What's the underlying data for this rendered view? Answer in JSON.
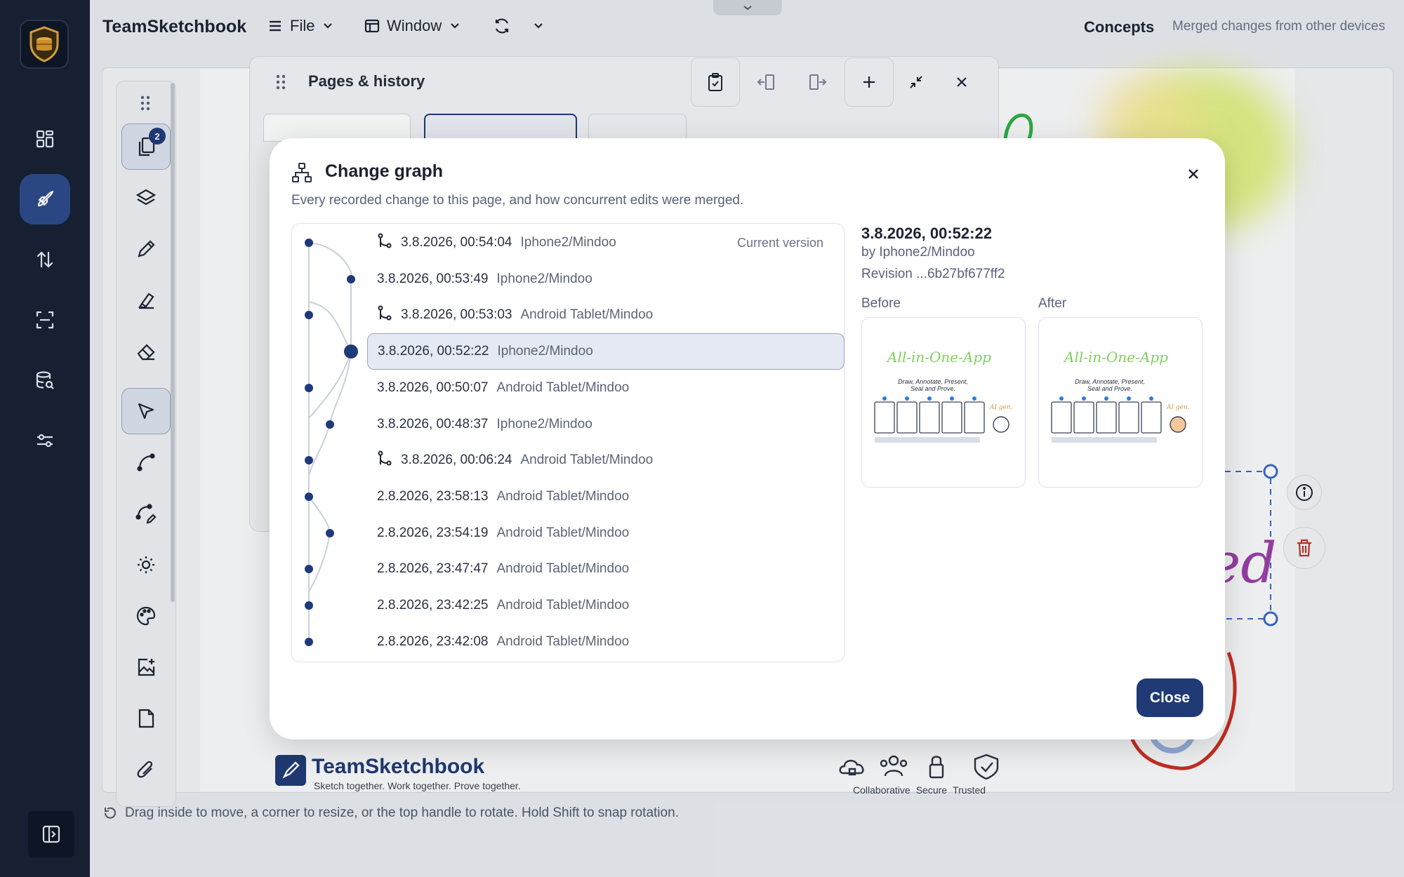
{
  "app": {
    "name": "TeamSketchbook"
  },
  "topbar": {
    "file_label": "File",
    "window_label": "Window",
    "status_title": "Concepts",
    "status_text": "Merged changes from other devices"
  },
  "leftnav": {
    "items": [
      {
        "name": "dashboard-icon"
      },
      {
        "name": "rocket-icon",
        "active": true
      },
      {
        "name": "sync-arrows-icon"
      },
      {
        "name": "scan-icon"
      },
      {
        "name": "database-search-icon"
      },
      {
        "name": "sliders-icon"
      }
    ]
  },
  "toolrail": {
    "pages_badge": "2",
    "tools": [
      "pages",
      "layers",
      "pencil",
      "highlighter",
      "eraser",
      "select",
      "curve",
      "curve-edit",
      "brightness",
      "palette",
      "add-image",
      "page",
      "attachment"
    ]
  },
  "pages_panel": {
    "title": "Pages & history"
  },
  "hint_text": "Drag inside to move, a corner to resize, or the top handle to rotate. Hold Shift to snap rotation.",
  "footer_brand": {
    "name": "TeamSketchbook",
    "tagline": "Sketch together. Work together. Prove together.",
    "icon_labels": [
      "Collaborative",
      "Secure",
      "Trusted"
    ]
  },
  "modal": {
    "title": "Change graph",
    "subtitle": "Every recorded change to this page, and how concurrent edits were merged.",
    "current_version_label": "Current version",
    "close_label": "Close",
    "changes": [
      {
        "time": "3.8.2026, 00:54:04",
        "device": "Iphone2/Mindoo",
        "merge": true
      },
      {
        "time": "3.8.2026, 00:53:49",
        "device": "Iphone2/Mindoo",
        "merge": false
      },
      {
        "time": "3.8.2026, 00:53:03",
        "device": "Android Tablet/Mindoo",
        "merge": true
      },
      {
        "time": "3.8.2026, 00:52:22",
        "device": "Iphone2/Mindoo",
        "merge": false,
        "selected": true
      },
      {
        "time": "3.8.2026, 00:50:07",
        "device": "Android Tablet/Mindoo",
        "merge": false
      },
      {
        "time": "3.8.2026, 00:48:37",
        "device": "Iphone2/Mindoo",
        "merge": false
      },
      {
        "time": "3.8.2026, 00:06:24",
        "device": "Android Tablet/Mindoo",
        "merge": true
      },
      {
        "time": "2.8.2026, 23:58:13",
        "device": "Android Tablet/Mindoo",
        "merge": false
      },
      {
        "time": "2.8.2026, 23:54:19",
        "device": "Android Tablet/Mindoo",
        "merge": false
      },
      {
        "time": "2.8.2026, 23:47:47",
        "device": "Android Tablet/Mindoo",
        "merge": false
      },
      {
        "time": "2.8.2026, 23:42:25",
        "device": "Android Tablet/Mindoo",
        "merge": false
      },
      {
        "time": "2.8.2026, 23:42:08",
        "device": "Android Tablet/Mindoo",
        "merge": false
      }
    ],
    "detail": {
      "time": "3.8.2026, 00:52:22",
      "by": "by Iphone2/Mindoo",
      "revision": "Revision ...6b27bf677ff2",
      "before_label": "Before",
      "after_label": "After",
      "preview_heading": "All-in-One-App",
      "preview_subheading": "Draw, Annotate, Present, Seal and Prove."
    }
  },
  "colors": {
    "accent": "#203a76",
    "nav_bg": "#172033",
    "graph_node": "#1f3a7a"
  }
}
